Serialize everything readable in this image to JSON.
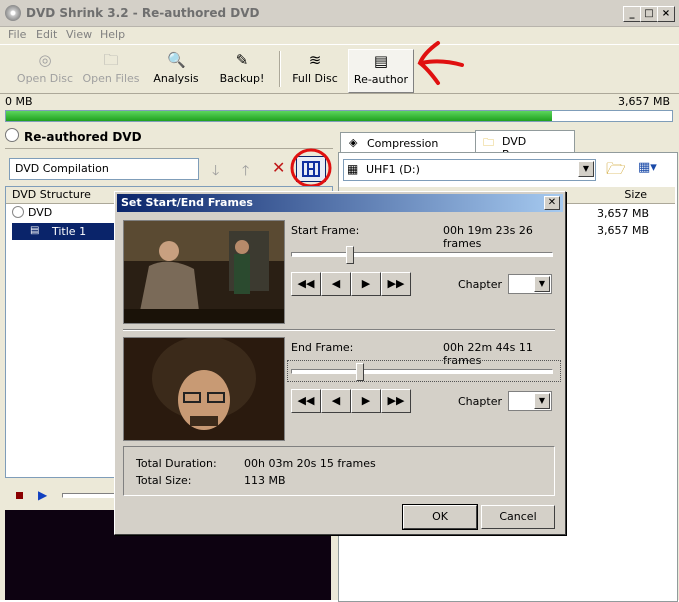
{
  "window": {
    "title": "DVD Shrink 3.2 - Re-authored DVD",
    "min": "_",
    "max": "□",
    "close": "×"
  },
  "menu": [
    "File",
    "Edit",
    "View",
    "Help"
  ],
  "toolbar": {
    "open_disc": "Open Disc",
    "open_files": "Open Files",
    "analysis": "Analysis",
    "backup": "Backup!",
    "full_disc": "Full Disc",
    "reauthor": "Re-author"
  },
  "progress": {
    "left": "0 MB",
    "right": "3,657 MB",
    "fill_fraction": 0.82
  },
  "left": {
    "header": "Re-authored DVD",
    "compilation_name": "DVD Compilation",
    "structure_header": "DVD Structure",
    "tree": [
      "DVD",
      "Title 1"
    ]
  },
  "right": {
    "tabs": [
      "Compression Settings",
      "DVD Browser"
    ],
    "drive": "UHF1 (D:)",
    "size_header": "Size",
    "sizes": [
      "3,657 MB",
      "3,657 MB"
    ]
  },
  "dialog": {
    "title": "Set Start/End Frames",
    "start_label": "Start Frame:",
    "start_value": "00h 19m 23s 26 frames",
    "end_label": "End Frame:",
    "end_value": "00h 22m 44s 11 frames",
    "start_slider": 0.21,
    "end_slider": 0.25,
    "chapter_label": "Chapter",
    "total_duration_label": "Total Duration:",
    "total_duration": "00h 03m 20s 15 frames",
    "total_size_label": "Total Size:",
    "total_size": "113 MB",
    "ok": "OK",
    "cancel": "Cancel"
  }
}
